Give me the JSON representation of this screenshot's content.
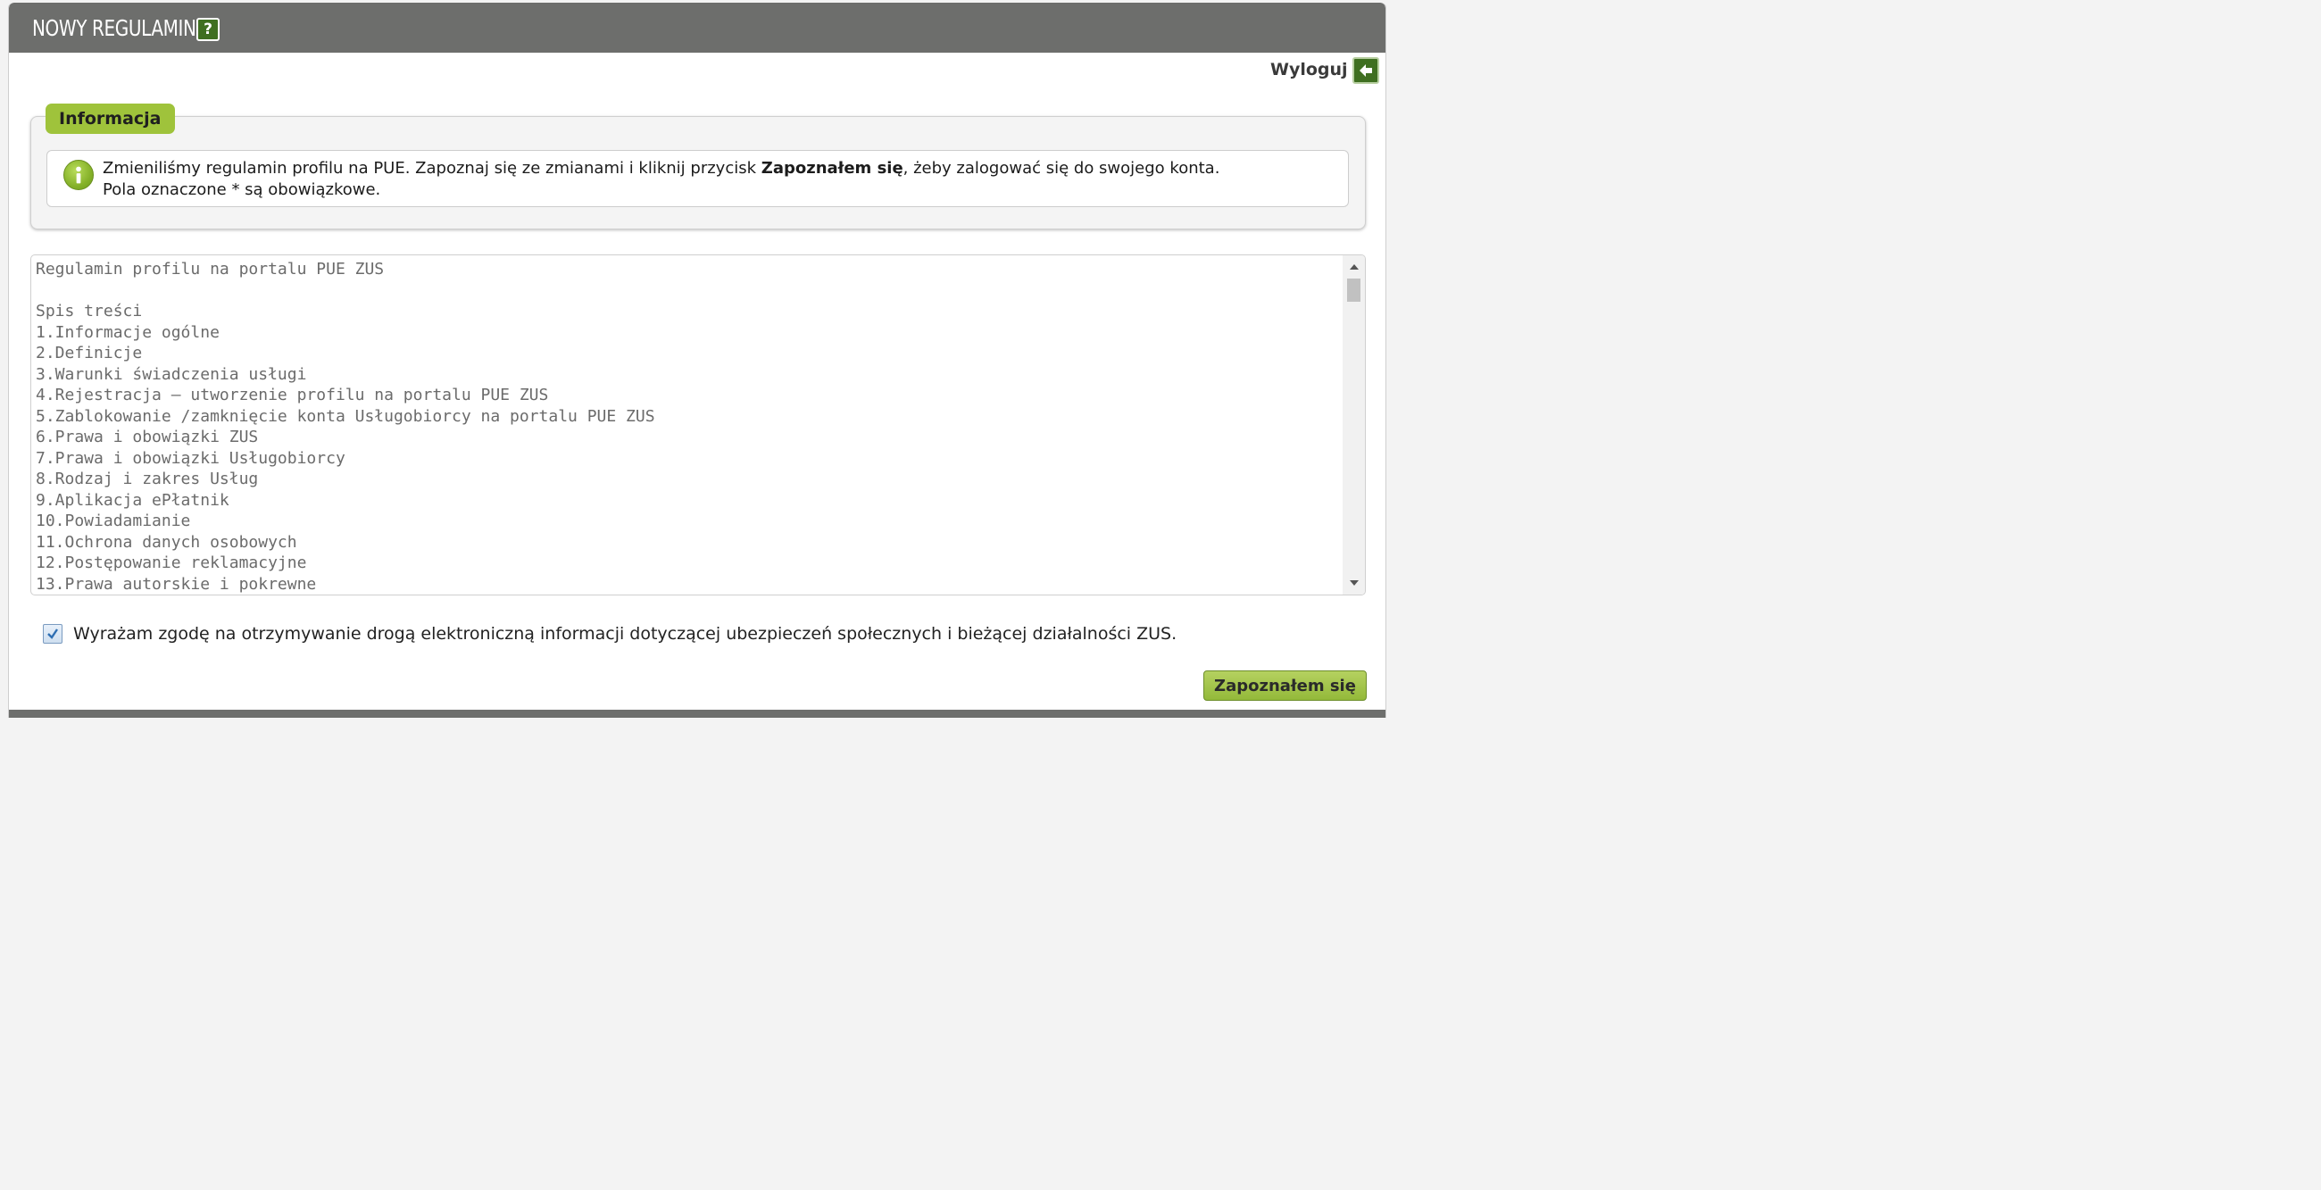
{
  "header": {
    "title": "NOWY REGULAMIN",
    "help_label": "?"
  },
  "logout": {
    "label": "Wyloguj"
  },
  "info": {
    "tab_label": "Informacja",
    "line1_before": "Zmieniliśmy regulamin profilu na PUE. Zapoznaj się ze zmianami i kliknij przycisk ",
    "line1_bold": "Zapoznałem się",
    "line1_after": ", żeby zalogować się do swojego konta.",
    "line2": "Pola oznaczone * są obowiązkowe."
  },
  "regulations": {
    "text": "Regulamin profilu na portalu PUE ZUS\n\nSpis treści\n1.Informacje ogólne\n2.Definicje\n3.Warunki świadczenia usługi\n4.Rejestracja – utworzenie profilu na portalu PUE ZUS\n5.Zablokowanie /zamknięcie konta Usługobiorcy na portalu PUE ZUS\n6.Prawa i obowiązki ZUS\n7.Prawa i obowiązki Usługobiorcy\n8.Rodzaj i zakres Usług\n9.Aplikacja ePłatnik\n10.Powiadamianie\n11.Ochrona danych osobowych\n12.Postępowanie reklamacyjne\n13.Prawa autorskie i pokrewne"
  },
  "consent": {
    "checked": true,
    "label": "Wyrażam zgodę na otrzymywanie drogą elektroniczną informacji dotyczącej ubezpieczeń społecznych i bieżącej działalności ZUS."
  },
  "submit": {
    "label": "Zapoznałem się"
  },
  "colors": {
    "header_bg": "#6d6e6c",
    "accent_green": "#9fc33b",
    "dark_green": "#3f6f21"
  }
}
